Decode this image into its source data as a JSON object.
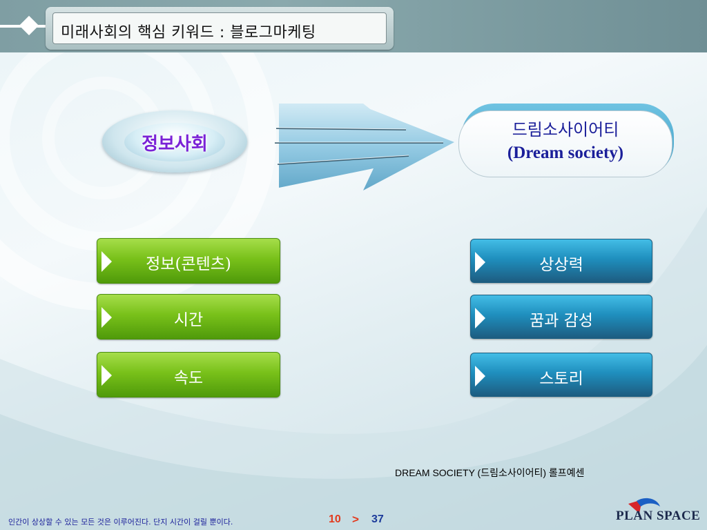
{
  "header": {
    "title": "미래사회의 핵심 키워드 : 블로그마케팅"
  },
  "diagram": {
    "from_label": "정보사회",
    "to_label_ko": "드림소사이어티",
    "to_label_en": "(Dream society)",
    "left_items": [
      "정보(콘텐츠)",
      "시간",
      "속도"
    ],
    "right_items": [
      "상상력",
      "꿈과 감성",
      "스토리"
    ]
  },
  "footer": {
    "caption": "DREAM SOCIETY (드림소사이어티)  롤프예센",
    "quote": "인간이 상상할 수 있는 모든 것은 이루어진다. 단지 시간이 걸릴 뿐이다.",
    "page_current": "10",
    "page_separator": ">",
    "page_total": "37",
    "logo": "PLAN SPACE"
  },
  "colors": {
    "accent_purple": "#7a22d6",
    "navy_text": "#1b1f9a",
    "green_button": "#79c11a",
    "blue_button": "#1f8fbe",
    "page_red": "#e23a1e"
  }
}
